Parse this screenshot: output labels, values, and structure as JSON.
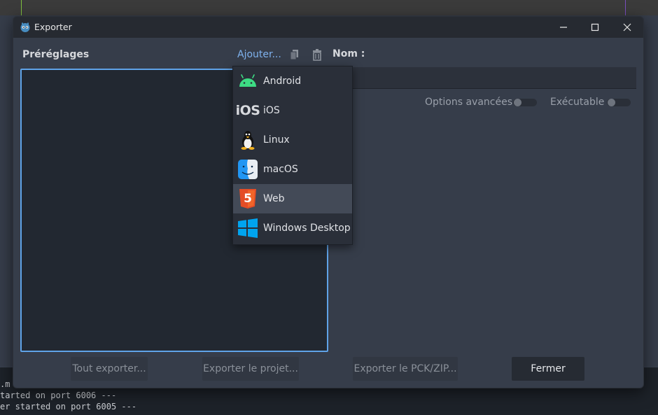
{
  "console": {
    "lines": [
      ".m",
      "tarted on port 6006 ---",
      "er started on port 6005 ---"
    ]
  },
  "window": {
    "title": "Exporter",
    "minimize_icon": "minimize-icon",
    "maximize_icon": "maximize-icon",
    "close_icon": "close-icon"
  },
  "presets": {
    "label": "Préréglages",
    "add_label": "Ajouter...",
    "duplicate_icon": "duplicate-icon",
    "delete_icon": "trash-icon"
  },
  "name": {
    "label": "Nom :"
  },
  "options": {
    "advanced_label": "Options avancées",
    "executable_label": "Exécutable"
  },
  "dropdown": {
    "items": [
      {
        "label": "Android",
        "icon": "android-icon"
      },
      {
        "label": "iOS",
        "icon": "ios-icon",
        "icon_text": "iOS"
      },
      {
        "label": "Linux",
        "icon": "linux-icon"
      },
      {
        "label": "macOS",
        "icon": "macos-icon"
      },
      {
        "label": "Web",
        "icon": "html5-icon",
        "icon_text": "5"
      },
      {
        "label": "Windows Desktop",
        "icon": "windows-icon"
      }
    ],
    "hovered_index": 4
  },
  "footer": {
    "export_all": "Tout exporter...",
    "export_project": "Exporter le projet...",
    "export_pck": "Exporter le PCK/ZIP...",
    "close": "Fermer"
  },
  "colors": {
    "accent": "#5fa3e8",
    "link": "#7fb2ee",
    "android": "#3ddc84",
    "html5": "#e44d26",
    "windows": "#00a4ef",
    "macos": "#1e90ff"
  }
}
